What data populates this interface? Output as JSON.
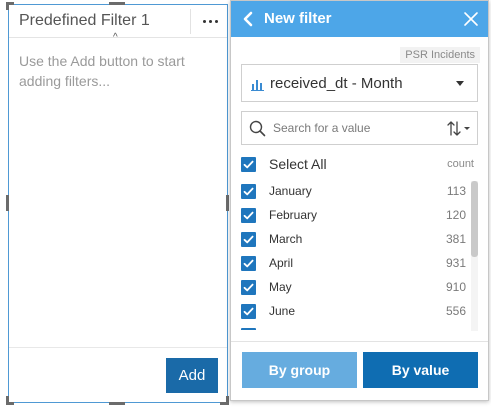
{
  "widget": {
    "title": "Predefined Filter 1",
    "help_text": "Use the Add button to start adding filters...",
    "add_label": "Add"
  },
  "panel": {
    "title": "New filter",
    "dataset": "PSR Incidents",
    "field_label": "received_dt - Month",
    "search_placeholder": "Search for a value",
    "select_all_label": "Select All",
    "count_header": "count",
    "items": [
      {
        "label": "January",
        "count": "113",
        "checked": true
      },
      {
        "label": "February",
        "count": "120",
        "checked": true
      },
      {
        "label": "March",
        "count": "381",
        "checked": true
      },
      {
        "label": "April",
        "count": "931",
        "checked": true
      },
      {
        "label": "May",
        "count": "910",
        "checked": true
      },
      {
        "label": "June",
        "count": "556",
        "checked": true
      }
    ],
    "by_group_label": "By group",
    "by_value_label": "By value"
  },
  "icons": {
    "more": "more-options-icon",
    "back": "chevron-left-icon",
    "close": "close-icon",
    "field": "bar-chart-icon",
    "search": "search-icon",
    "sort": "sort-icon",
    "check": "checkmark-icon"
  },
  "colors": {
    "header": "#4da6e8",
    "checkbox": "#1f76bd",
    "by_group": "#66acdf",
    "by_value": "#0f6db2",
    "add_button": "#1a6aa8"
  }
}
